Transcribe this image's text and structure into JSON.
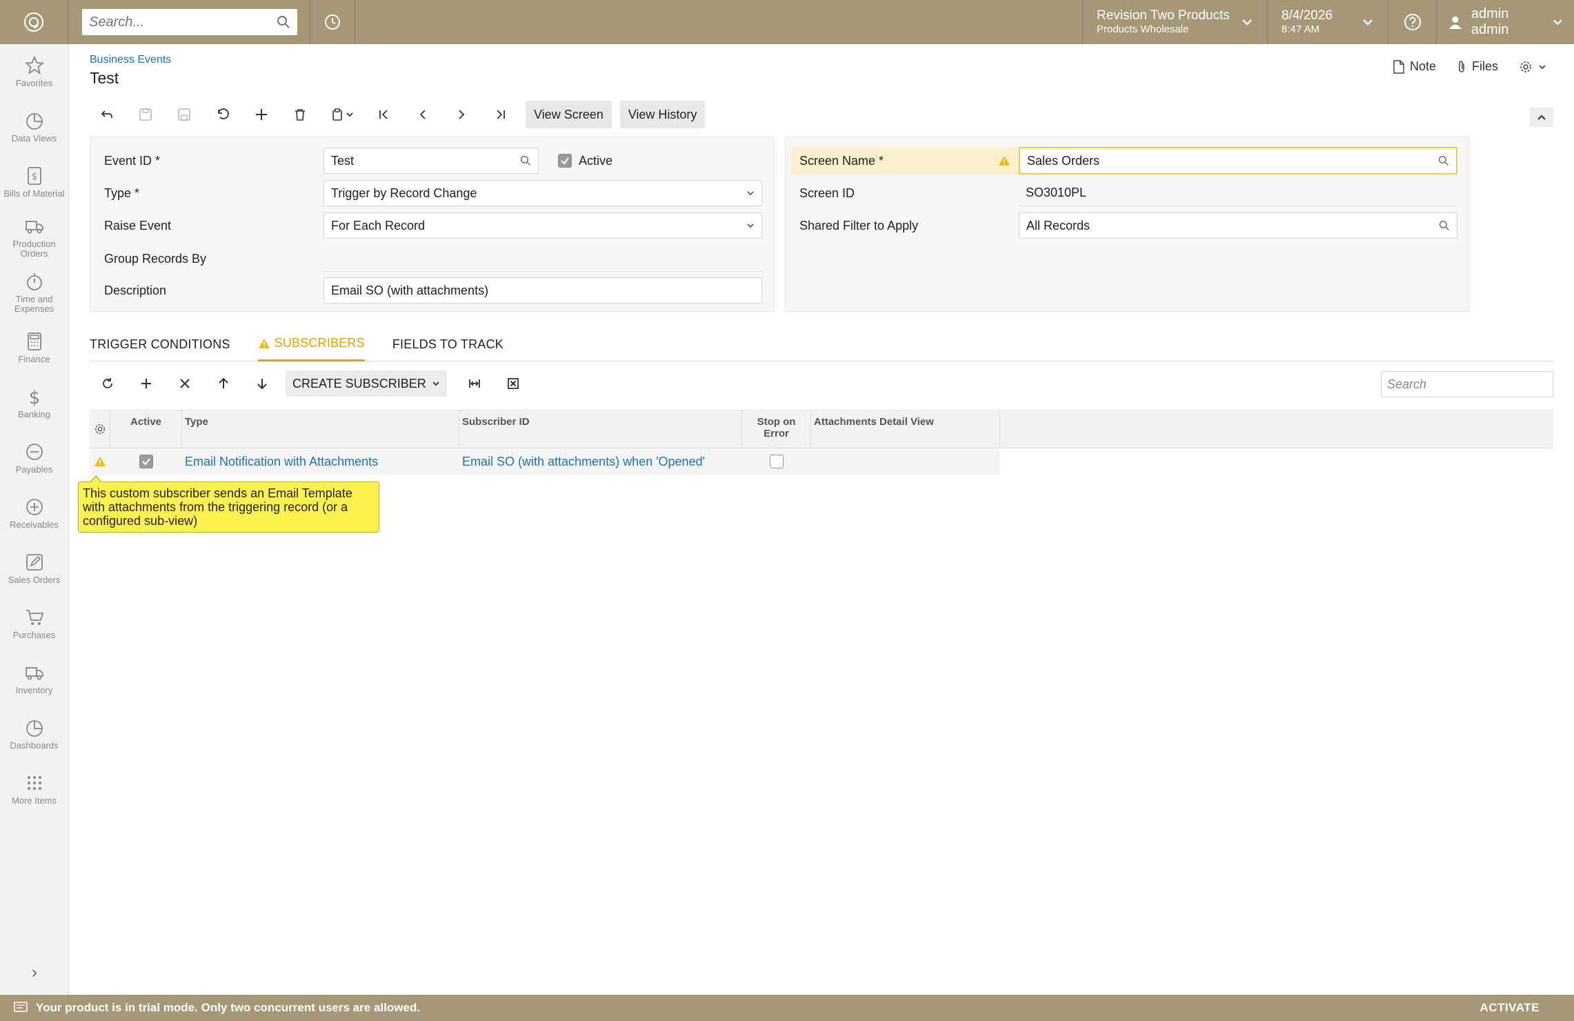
{
  "topbar": {
    "search_placeholder": "Search...",
    "company_name": "Revision Two Products",
    "company_branch": "Products Wholesale",
    "date": "8/4/2026",
    "time": "8:47 AM",
    "user": "admin admin"
  },
  "nav": {
    "items": [
      {
        "label": "Favorites",
        "icon": "star-icon"
      },
      {
        "label": "Data Views",
        "icon": "pie-chart-icon"
      },
      {
        "label": "Bills of Material",
        "icon": "document-dollar-icon"
      },
      {
        "label": "Production Orders",
        "icon": "truck-icon"
      },
      {
        "label": "Time and Expenses",
        "icon": "stopwatch-icon"
      },
      {
        "label": "Finance",
        "icon": "calculator-icon"
      },
      {
        "label": "Banking",
        "icon": "dollar-icon"
      },
      {
        "label": "Payables",
        "icon": "minus-circle-icon"
      },
      {
        "label": "Receivables",
        "icon": "plus-circle-icon"
      },
      {
        "label": "Sales Orders",
        "icon": "pencil-icon"
      },
      {
        "label": "Purchases",
        "icon": "cart-icon"
      },
      {
        "label": "Inventory",
        "icon": "truck-icon"
      },
      {
        "label": "Dashboards",
        "icon": "pie-chart-icon"
      },
      {
        "label": "More Items",
        "icon": "grid-dots-icon"
      }
    ]
  },
  "page": {
    "breadcrumb": "Business Events",
    "title": "Test",
    "note_label": "Note",
    "files_label": "Files"
  },
  "toolbar": {
    "view_screen": "View Screen",
    "view_history": "View History"
  },
  "form": {
    "event_id_label": "Event ID *",
    "event_id_value": "Test",
    "active_label": "Active",
    "active_checked": true,
    "type_label": "Type *",
    "type_value": "Trigger by Record Change",
    "raise_event_label": "Raise Event",
    "raise_event_value": "For Each Record",
    "group_records_label": "Group Records By",
    "group_records_value": "",
    "description_label": "Description",
    "description_value": "Email SO (with attachments)",
    "screen_name_label": "Screen Name *",
    "screen_name_value": "Sales Orders",
    "screen_id_label": "Screen ID",
    "screen_id_value": "SO3010PL",
    "shared_filter_label": "Shared Filter to Apply",
    "shared_filter_value": "All Records"
  },
  "tabs": [
    {
      "label": "TRIGGER CONDITIONS",
      "active": false
    },
    {
      "label": "SUBSCRIBERS",
      "active": true,
      "warning": true
    },
    {
      "label": "FIELDS TO TRACK",
      "active": false
    }
  ],
  "grid_toolbar": {
    "create_subscriber": "CREATE SUBSCRIBER",
    "search_placeholder": "Search"
  },
  "grid": {
    "headers": {
      "active": "Active",
      "type": "Type",
      "subscriber_id": "Subscriber ID",
      "stop_on_error": "Stop on Error",
      "attachments_detail_view": "Attachments Detail View"
    },
    "rows": [
      {
        "active": true,
        "type": "Email Notification with Attachments",
        "subscriber_id": "Email SO (with attachments) when 'Opened'",
        "stop_on_error": false,
        "attachments_detail_view": ""
      }
    ]
  },
  "tooltip": {
    "text": "This custom subscriber sends an Email Template with attachments from the triggering record (or a configured sub-view)"
  },
  "statusbar": {
    "message": "Your product is in trial mode. Only two concurrent users are allowed.",
    "activate": "ACTIVATE"
  },
  "colors": {
    "brand": "#a69877",
    "link": "#1a73b8",
    "warning": "#e8a100",
    "tooltip": "#fdf14f"
  }
}
